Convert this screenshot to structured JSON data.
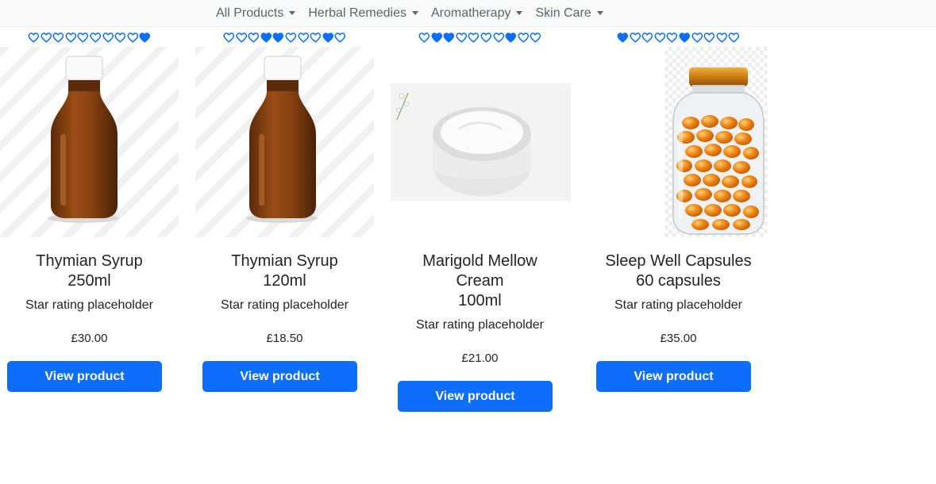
{
  "nav": {
    "items": [
      {
        "label": "All Products"
      },
      {
        "label": "Herbal Remedies"
      },
      {
        "label": "Aromatherapy"
      },
      {
        "label": "Skin Care"
      }
    ]
  },
  "accent_color": "#0d6efd",
  "products": [
    {
      "title_lines": [
        "Thymian Syrup",
        "250ml"
      ],
      "rating_text": "Star rating placeholder",
      "price": "£30.00",
      "button_label": "View product",
      "hearts": [
        false,
        false,
        false,
        false,
        false,
        false,
        false,
        false,
        false,
        true
      ],
      "image": "amber-syrup-bottle"
    },
    {
      "title_lines": [
        "Thymian Syrup",
        "120ml"
      ],
      "rating_text": "Star rating placeholder",
      "price": "£18.50",
      "button_label": "View product",
      "hearts": [
        false,
        false,
        false,
        true,
        true,
        false,
        false,
        false,
        true,
        false
      ],
      "image": "amber-syrup-bottle"
    },
    {
      "title_lines": [
        "Marigold Mellow",
        "Cream",
        "100ml"
      ],
      "rating_text": "Star rating placeholder",
      "price": "£21.00",
      "button_label": "View product",
      "hearts": [
        false,
        true,
        true,
        false,
        false,
        false,
        false,
        true,
        false,
        false
      ],
      "image": "cream-jar"
    },
    {
      "title_lines": [
        "Sleep Well Capsules",
        "60 capsules"
      ],
      "rating_text": "Star rating placeholder",
      "price": "£35.00",
      "button_label": "View product",
      "hearts": [
        true,
        false,
        false,
        false,
        false,
        true,
        false,
        false,
        false,
        false
      ],
      "image": "capsule-jar"
    }
  ]
}
